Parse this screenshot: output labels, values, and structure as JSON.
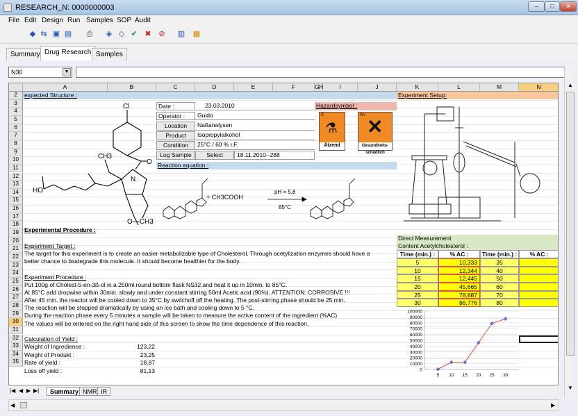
{
  "window": {
    "title": "RESEARCH_N: 0000000003",
    "controls": [
      "–",
      "□",
      "✕"
    ]
  },
  "menu": [
    "File",
    "Edit",
    "Design",
    "Run",
    "Samples",
    "SOP",
    "Audit"
  ],
  "tabs": [
    "Summary",
    "Drug Research",
    "Samples"
  ],
  "active_tab": "Drug Research",
  "namebox": "N30",
  "columns": [
    "A",
    "B",
    "C",
    "D",
    "E",
    "F",
    "G",
    "H",
    "I",
    "J",
    "K",
    "L",
    "M",
    "N"
  ],
  "rows": [
    "2",
    "3",
    "4",
    "5",
    "6",
    "7",
    "8",
    "9",
    "10",
    "11",
    "12",
    "13",
    "14",
    "15",
    "16",
    "17",
    "18",
    "19",
    "20",
    "21",
    "22",
    "23",
    "24",
    "25",
    "26",
    "27",
    "28",
    "29",
    "30",
    "31",
    "32",
    "33",
    "34",
    "35"
  ],
  "sections": {
    "expected": "expected Structure :",
    "setup": "Experiment Setup:",
    "hazard": "Hazardsymbol :",
    "reaction": "Reaction equation :",
    "procedure": "Experimental Procedure :"
  },
  "info": {
    "date_label": "Date :",
    "date": "23.03.2010",
    "operator_label": "Operator :",
    "operator": "Guido",
    "location_label": "Location",
    "location": "Naßanalysen",
    "product_label": "Product",
    "product": "Isopropylalkohol",
    "condition_label": "Condition",
    "condition": "25°C / 60 % r.F.",
    "logsample_label": "Log Sample",
    "select_label": "Select",
    "logsample": "18.11.2010--288"
  },
  "hazards": [
    {
      "code": "C",
      "label": "Ätzend"
    },
    {
      "code": "Xn",
      "label": "Gesundheits-schädlich"
    }
  ],
  "reaction": {
    "reagent": "+ CH3COOH",
    "condition_top": "pH = 5,8",
    "condition_bottom": "85°C"
  },
  "structure_labels": {
    "cl": "Cl",
    "o": "O",
    "n": "N",
    "ch3": "CH3",
    "ho": "HO",
    "och3": "O—CH3"
  },
  "text": {
    "target_h": "Experiment Target :",
    "r20": "The target for this experiment is to create an easier metabolizable type of Cholesterol. Through acetylization enzymes should have a",
    "r21": "better chance to biodegrade this molecule. It should become healthier for the body.",
    "proc_h": "Experiment Procedure :",
    "r23": "Put 100g of Cholest-5-en-3ß-ol in a 250ml round bottom flask NS32 and heat it up in 10min. to 85°C.",
    "r24": "At 85°C add dropwise within 30min. slowly and under constant stirring 50ml Acetic acid (90%). ATTENTION: CORROSIVE !!!",
    "r25": "After 45 min. the reactor will be cooled down to 35°C by switchoff off the heating. The post-stirring phase should be 25 min.",
    "r26": "The reaction will be stopped dramatically by using an ice bath and cooling down to 5 °C.",
    "r27": "During the reaction phase every 5 minutes a sample will be taken to measure the active content of the ingredient (%AC)",
    "r28": "The values will be entered on the right hand side of this screen to show the time dependence of this reaction.",
    "yield_h": "Calculation of Yield :"
  },
  "yield": [
    {
      "label": "Weight of Ingredience :",
      "value": "123,22"
    },
    {
      "label": "Weight of Produkt :",
      "value": "23,25"
    },
    {
      "label": "Rate of yield :",
      "value": "18,87"
    },
    {
      "label": "Loss off yield :",
      "value": "81,13"
    }
  ],
  "measurement": {
    "title": "Direct Measurement",
    "subtitle": "Content Acetylcholesterol :",
    "h_time": "Time (min.) :",
    "h_ac": "% AC :",
    "left": [
      [
        "5",
        "10,333"
      ],
      [
        "10",
        "12,344"
      ],
      [
        "15",
        "12,445"
      ],
      [
        "20",
        "45,665"
      ],
      [
        "25",
        "78,887"
      ],
      [
        "30",
        "86,776"
      ]
    ],
    "right": [
      "35",
      "40",
      "50",
      "60",
      "70",
      "80"
    ]
  },
  "chart_data": {
    "type": "line",
    "x": [
      5,
      10,
      15,
      20,
      25,
      30
    ],
    "values": [
      333,
      12344,
      12445,
      45665,
      78887,
      86776
    ],
    "ylim": [
      0,
      100000
    ],
    "yticks": [
      "0",
      "10000",
      "20000",
      "30000",
      "40000",
      "50000",
      "60000",
      "70000",
      "80000",
      "90000",
      "100000"
    ],
    "xticks": [
      "5",
      "10",
      "15",
      "20",
      "25",
      "30"
    ]
  },
  "sheet_tabs": [
    "Summary",
    "NMR",
    "IR"
  ]
}
